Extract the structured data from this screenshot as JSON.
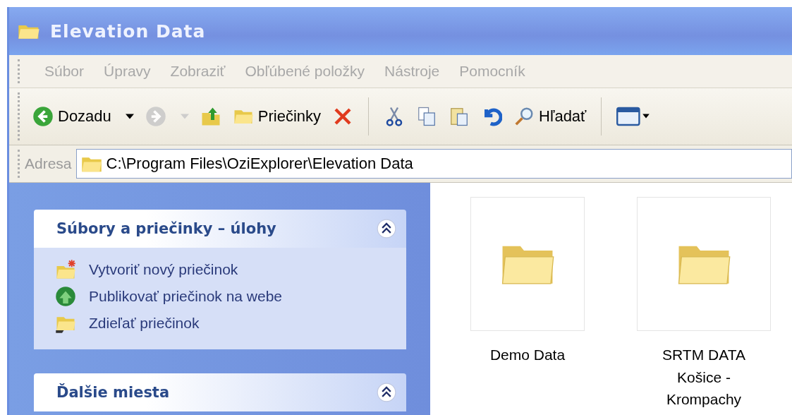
{
  "window": {
    "title": "Elevation Data"
  },
  "menu": [
    "Súbor",
    "Úpravy",
    "Zobraziť",
    "Obľúbené položky",
    "Nástroje",
    "Pomocník"
  ],
  "toolbar": [
    {
      "kind": "back",
      "label": "Dozadu",
      "disabled": false
    },
    {
      "kind": "forward",
      "disabled": true
    },
    {
      "kind": "up",
      "disabled": false
    },
    {
      "kind": "folders",
      "label": "Priečinky",
      "disabled": false
    },
    {
      "kind": "delete",
      "disabled": false
    },
    {
      "kind": "separator"
    },
    {
      "kind": "cut",
      "disabled": false
    },
    {
      "kind": "copy",
      "disabled": false
    },
    {
      "kind": "paste",
      "disabled": false
    },
    {
      "kind": "undo",
      "disabled": false
    },
    {
      "kind": "search",
      "label": "Hľadať",
      "disabled": false
    },
    {
      "kind": "separator"
    },
    {
      "kind": "views",
      "disabled": false
    }
  ],
  "address": {
    "label": "Adresa",
    "value": "C:\\Program Files\\OziExplorer\\Elevation Data"
  },
  "panels": [
    {
      "title": "Súbory a priečinky – úlohy",
      "expanded": true,
      "items": [
        {
          "kind": "new-folder",
          "label": "Vytvoriť nový priečinok"
        },
        {
          "kind": "publish",
          "label": "Publikovať priečinok na webe"
        },
        {
          "kind": "share",
          "label": "Zdieľať priečinok"
        }
      ]
    },
    {
      "title": "Ďalšie miesta",
      "expanded": true
    }
  ],
  "folders": [
    {
      "name": "Demo Data"
    },
    {
      "name": "SRTM DATA Košice - Krompachy"
    }
  ]
}
